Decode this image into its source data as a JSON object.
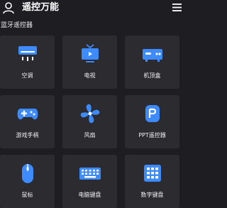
{
  "header": {
    "title": "遥控万能",
    "avatar_icon": "user-avatar-icon",
    "menu_icon": "hamburger-menu-icon"
  },
  "section": {
    "title": "蓝牙遥控器"
  },
  "accent_color": "#3d8bff",
  "tiles": [
    {
      "label": "空调",
      "icon": "air-conditioner-icon"
    },
    {
      "label": "电视",
      "icon": "tv-icon"
    },
    {
      "label": "机顶盒",
      "icon": "set-top-box-icon"
    },
    {
      "label": "游戏手柄",
      "icon": "gamepad-icon"
    },
    {
      "label": "风扇",
      "icon": "fan-icon"
    },
    {
      "label": "PPT遥控器",
      "icon": "ppt-remote-icon"
    },
    {
      "label": "鼠标",
      "icon": "mouse-icon"
    },
    {
      "label": "电脑键盘",
      "icon": "keyboard-icon"
    },
    {
      "label": "数字键盘",
      "icon": "numpad-icon"
    }
  ]
}
